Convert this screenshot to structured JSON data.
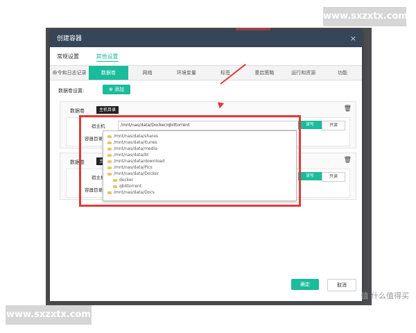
{
  "watermark": {
    "top": "www.sxzxtx.com",
    "bottom": "www.sxzxtx.com"
  },
  "brand": "值 什么值得买",
  "dialog": {
    "title": "创建容器",
    "close": "×",
    "top_tabs": [
      "常规设置",
      "其他设置"
    ],
    "sub_tabs": [
      "命令和日志记录",
      "数据卷",
      "网络",
      "环境变量",
      "标签",
      "重启策略",
      "运行和资源",
      "功能"
    ],
    "volume_label": "数据卷设置:",
    "add_button": "⊕ 添加",
    "card1": {
      "label": "数据卷",
      "tag": "主机目录",
      "host_label": "宿主机",
      "host_value": "/mnt/nas/data/Docker/qbittorrent",
      "container_label": "容器目录",
      "rw": "读写",
      "ro": "只读"
    },
    "card2": {
      "label": "数据卷",
      "tag": "主机目",
      "host_label": "宿主机",
      "container_label": "容器目录",
      "rw": "读写",
      "ro": "只读"
    },
    "dropdown_items": [
      "/mnt/nas/data/shares",
      "/mnt/nas/data/itunes",
      "/mnt/nas/data/media",
      "/mnt/nas/data/bt",
      "/mnt/nas/data/download",
      "/mnt/nas/data/Pics",
      "/mnt/nas/data/Docker",
      "docker",
      "qbittorrent",
      "/mnt/nas/data/Docs"
    ],
    "ok": "确定",
    "cancel": "取消"
  },
  "trash_icon": "trash-icon",
  "accent": "#1abc9c",
  "highlight_color": "#e03a3a"
}
